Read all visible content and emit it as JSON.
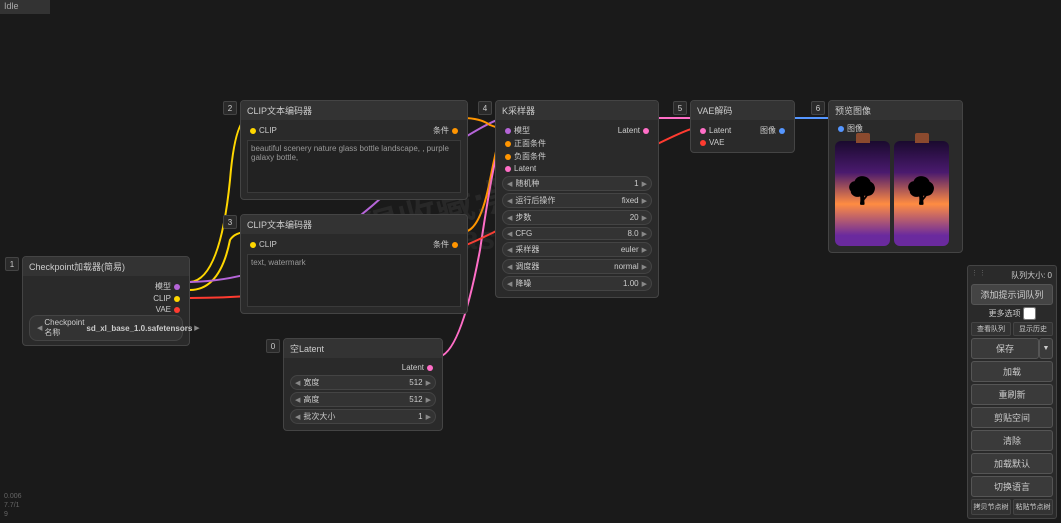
{
  "topbar": {
    "status": "Idle"
  },
  "nodes": {
    "checkpoint": {
      "num": "1",
      "title": "Checkpoint加载器(简易)",
      "outputs": {
        "model": "模型",
        "clip": "CLIP",
        "vae": "VAE"
      },
      "ckpt_label": "Checkpoint名称",
      "ckpt_value": "sd_xl_base_1.0.safetensors"
    },
    "clip_pos": {
      "num": "2",
      "title": "CLIP文本编码器",
      "input": "CLIP",
      "output": "条件",
      "text": "beautiful scenery nature glass bottle landscape, , purple galaxy bottle,"
    },
    "clip_neg": {
      "num": "3",
      "title": "CLIP文本编码器",
      "input": "CLIP",
      "output": "条件",
      "text": "text, watermark"
    },
    "latent": {
      "num": "0",
      "title": "空Latent",
      "output": "Latent",
      "widgets": [
        {
          "label": "宽度",
          "value": "512"
        },
        {
          "label": "高度",
          "value": "512"
        },
        {
          "label": "批次大小",
          "value": "1"
        }
      ]
    },
    "ksampler": {
      "num": "4",
      "title": "K采样器",
      "inputs": {
        "model": "模型",
        "positive": "正面条件",
        "negative": "负面条件",
        "latent": "Latent"
      },
      "output": "Latent",
      "widgets": [
        {
          "label": "随机种",
          "value": "1"
        },
        {
          "label": "运行后操作",
          "value": "fixed"
        },
        {
          "label": "步数",
          "value": "20"
        },
        {
          "label": "CFG",
          "value": "8.0"
        },
        {
          "label": "采样器",
          "value": "euler"
        },
        {
          "label": "调度器",
          "value": "normal"
        },
        {
          "label": "降噪",
          "value": "1.00"
        }
      ]
    },
    "vae_decode": {
      "num": "5",
      "title": "VAE解码",
      "inputs": {
        "latent": "Latent",
        "vae": "VAE"
      },
      "output": "图像"
    },
    "preview": {
      "num": "6",
      "title": "预览图像",
      "input": "图像"
    }
  },
  "sidepanel": {
    "queue_size": "队列大小: 0",
    "add_queue": "添加提示词队列",
    "more_options": "更多选项",
    "view_queue": "查看队列",
    "view_history": "显示历史",
    "save": "保存",
    "load": "加载",
    "refresh": "重刷新",
    "clipspace": "剪贴空间",
    "clear": "清除",
    "load_default": "加载默认",
    "switch_lang": "切换语言",
    "copy_tree": "拷贝节点树",
    "paste_tree": "粘贴节点树"
  },
  "stats": {
    "line1": "0.006",
    "line2": "7.7/1",
    "line3": "9"
  },
  "watermark": {
    "text1": "记得收藏:黑域基地",
    "text2": "Hybase.com"
  }
}
